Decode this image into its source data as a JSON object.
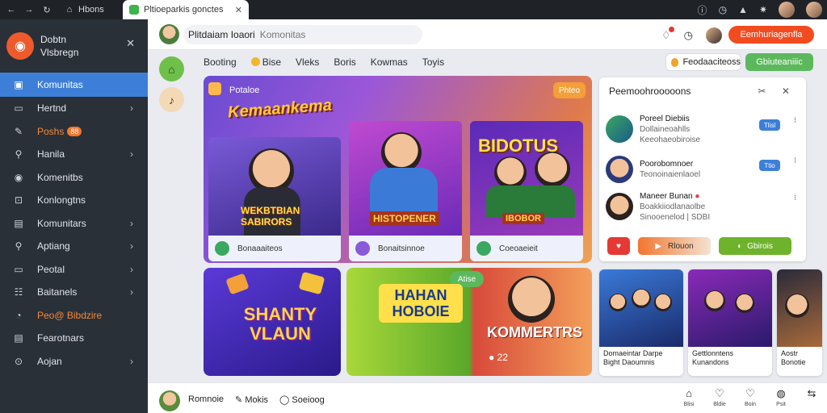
{
  "browser": {
    "nav_icons": [
      "back-arrow",
      "forward-arrow",
      "reload",
      "home"
    ],
    "site_label": "Hbons",
    "tab_title": "Pltioeparkis gonctes",
    "tab_close": "✕"
  },
  "sidebar": {
    "title_line1": "Dobtn",
    "title_line2": "Vlsbregn",
    "close": "✕",
    "items": [
      {
        "label": "Komunitas",
        "icon": "▣",
        "active": true
      },
      {
        "label": "Hertnd",
        "icon": "▭",
        "chevron": "›"
      },
      {
        "label": "Poshs",
        "icon": "✎",
        "badge": "88",
        "orange": true
      },
      {
        "label": "Hanila",
        "icon": "⚲",
        "chevron": "›"
      },
      {
        "label": "Komenitbs",
        "icon": "◉"
      },
      {
        "label": "Konlongtns",
        "icon": "⊡"
      },
      {
        "label": "Komunitars",
        "icon": "▤",
        "chevron": "›"
      },
      {
        "label": "Aptiang",
        "icon": "⚲",
        "chevron": "›"
      },
      {
        "label": "Peotal",
        "icon": "▭",
        "chevron": "›"
      },
      {
        "label": "Baitanels",
        "icon": "☷",
        "chevron": "›"
      },
      {
        "label": "Peo@ Bibdzire",
        "icon": "◔",
        "orange": true
      },
      {
        "label": "Fearotnars",
        "icon": "▤"
      },
      {
        "label": "Aojan",
        "icon": "⊙",
        "chevron": "›"
      }
    ]
  },
  "topbar": {
    "search_name": "Plitdaiam Ioaori",
    "search_hint": "Komonitas",
    "cta_label": "Eemhuriagenfla"
  },
  "categories": [
    "Booting",
    "Bise",
    "Vleks",
    "Boris",
    "Kowmas",
    "Toyis"
  ],
  "pill_white": "Feodaaciteoss",
  "pill_green": "Gbiuteaniiic",
  "hero": {
    "sub": "Potaloe",
    "title": "Kemaankema",
    "tag": "Phteo",
    "cards": [
      {
        "big": "WEKBTBIAN SABIRORS",
        "foot": "Bonaaaiteos"
      },
      {
        "big": "HISTOPENER",
        "foot": "Bonaitsinnoe"
      },
      {
        "big": "BIDOTUS",
        "foot": "Coeoaeieit",
        "sub": "IBOBOR"
      }
    ]
  },
  "rpanel": {
    "title": "Peemoohrooooons",
    "icons": "✂ ✕",
    "rows": [
      {
        "name": "Poreel Diebiis",
        "sub1": "Dollaineoahlls",
        "sub2": "Keeohaeobiroise",
        "btn": "Tlisl"
      },
      {
        "name": "Poorobomnoer",
        "sub1": "Teonoinaienlaoel",
        "btn": "Ttio"
      },
      {
        "name": "Maneer Bunan",
        "sub1": "Boakkiiodlanaolbe",
        "sub2": "Sinooenelod  |  SDBI"
      }
    ],
    "actions": [
      "Rlouon",
      "Gbirois"
    ]
  },
  "tiles": [
    {
      "big": "SHANTY VLAUN"
    },
    {
      "big": "HAHAN HOBOIE",
      "tag": "Atise"
    },
    {
      "big": "KOMMERTRS",
      "sub": "● 22"
    }
  ],
  "small_cards": [
    {
      "cap": "Domaeintar Darpe Bight Daoumnis"
    },
    {
      "cap": "Gettlonntens Kunandons"
    },
    {
      "cap": "Aostr Bonotie"
    }
  ],
  "bottombar": {
    "name": "Romnoie",
    "a1": "Mokis",
    "a2": "Soeioog",
    "nav": [
      {
        "icon": "⌂",
        "label": "Blisi"
      },
      {
        "icon": "♡",
        "label": "Bldie"
      },
      {
        "icon": "♡",
        "label": "Boin"
      },
      {
        "icon": "◍",
        "label": "Psit"
      },
      {
        "icon": "⇆",
        "label": ""
      }
    ]
  }
}
